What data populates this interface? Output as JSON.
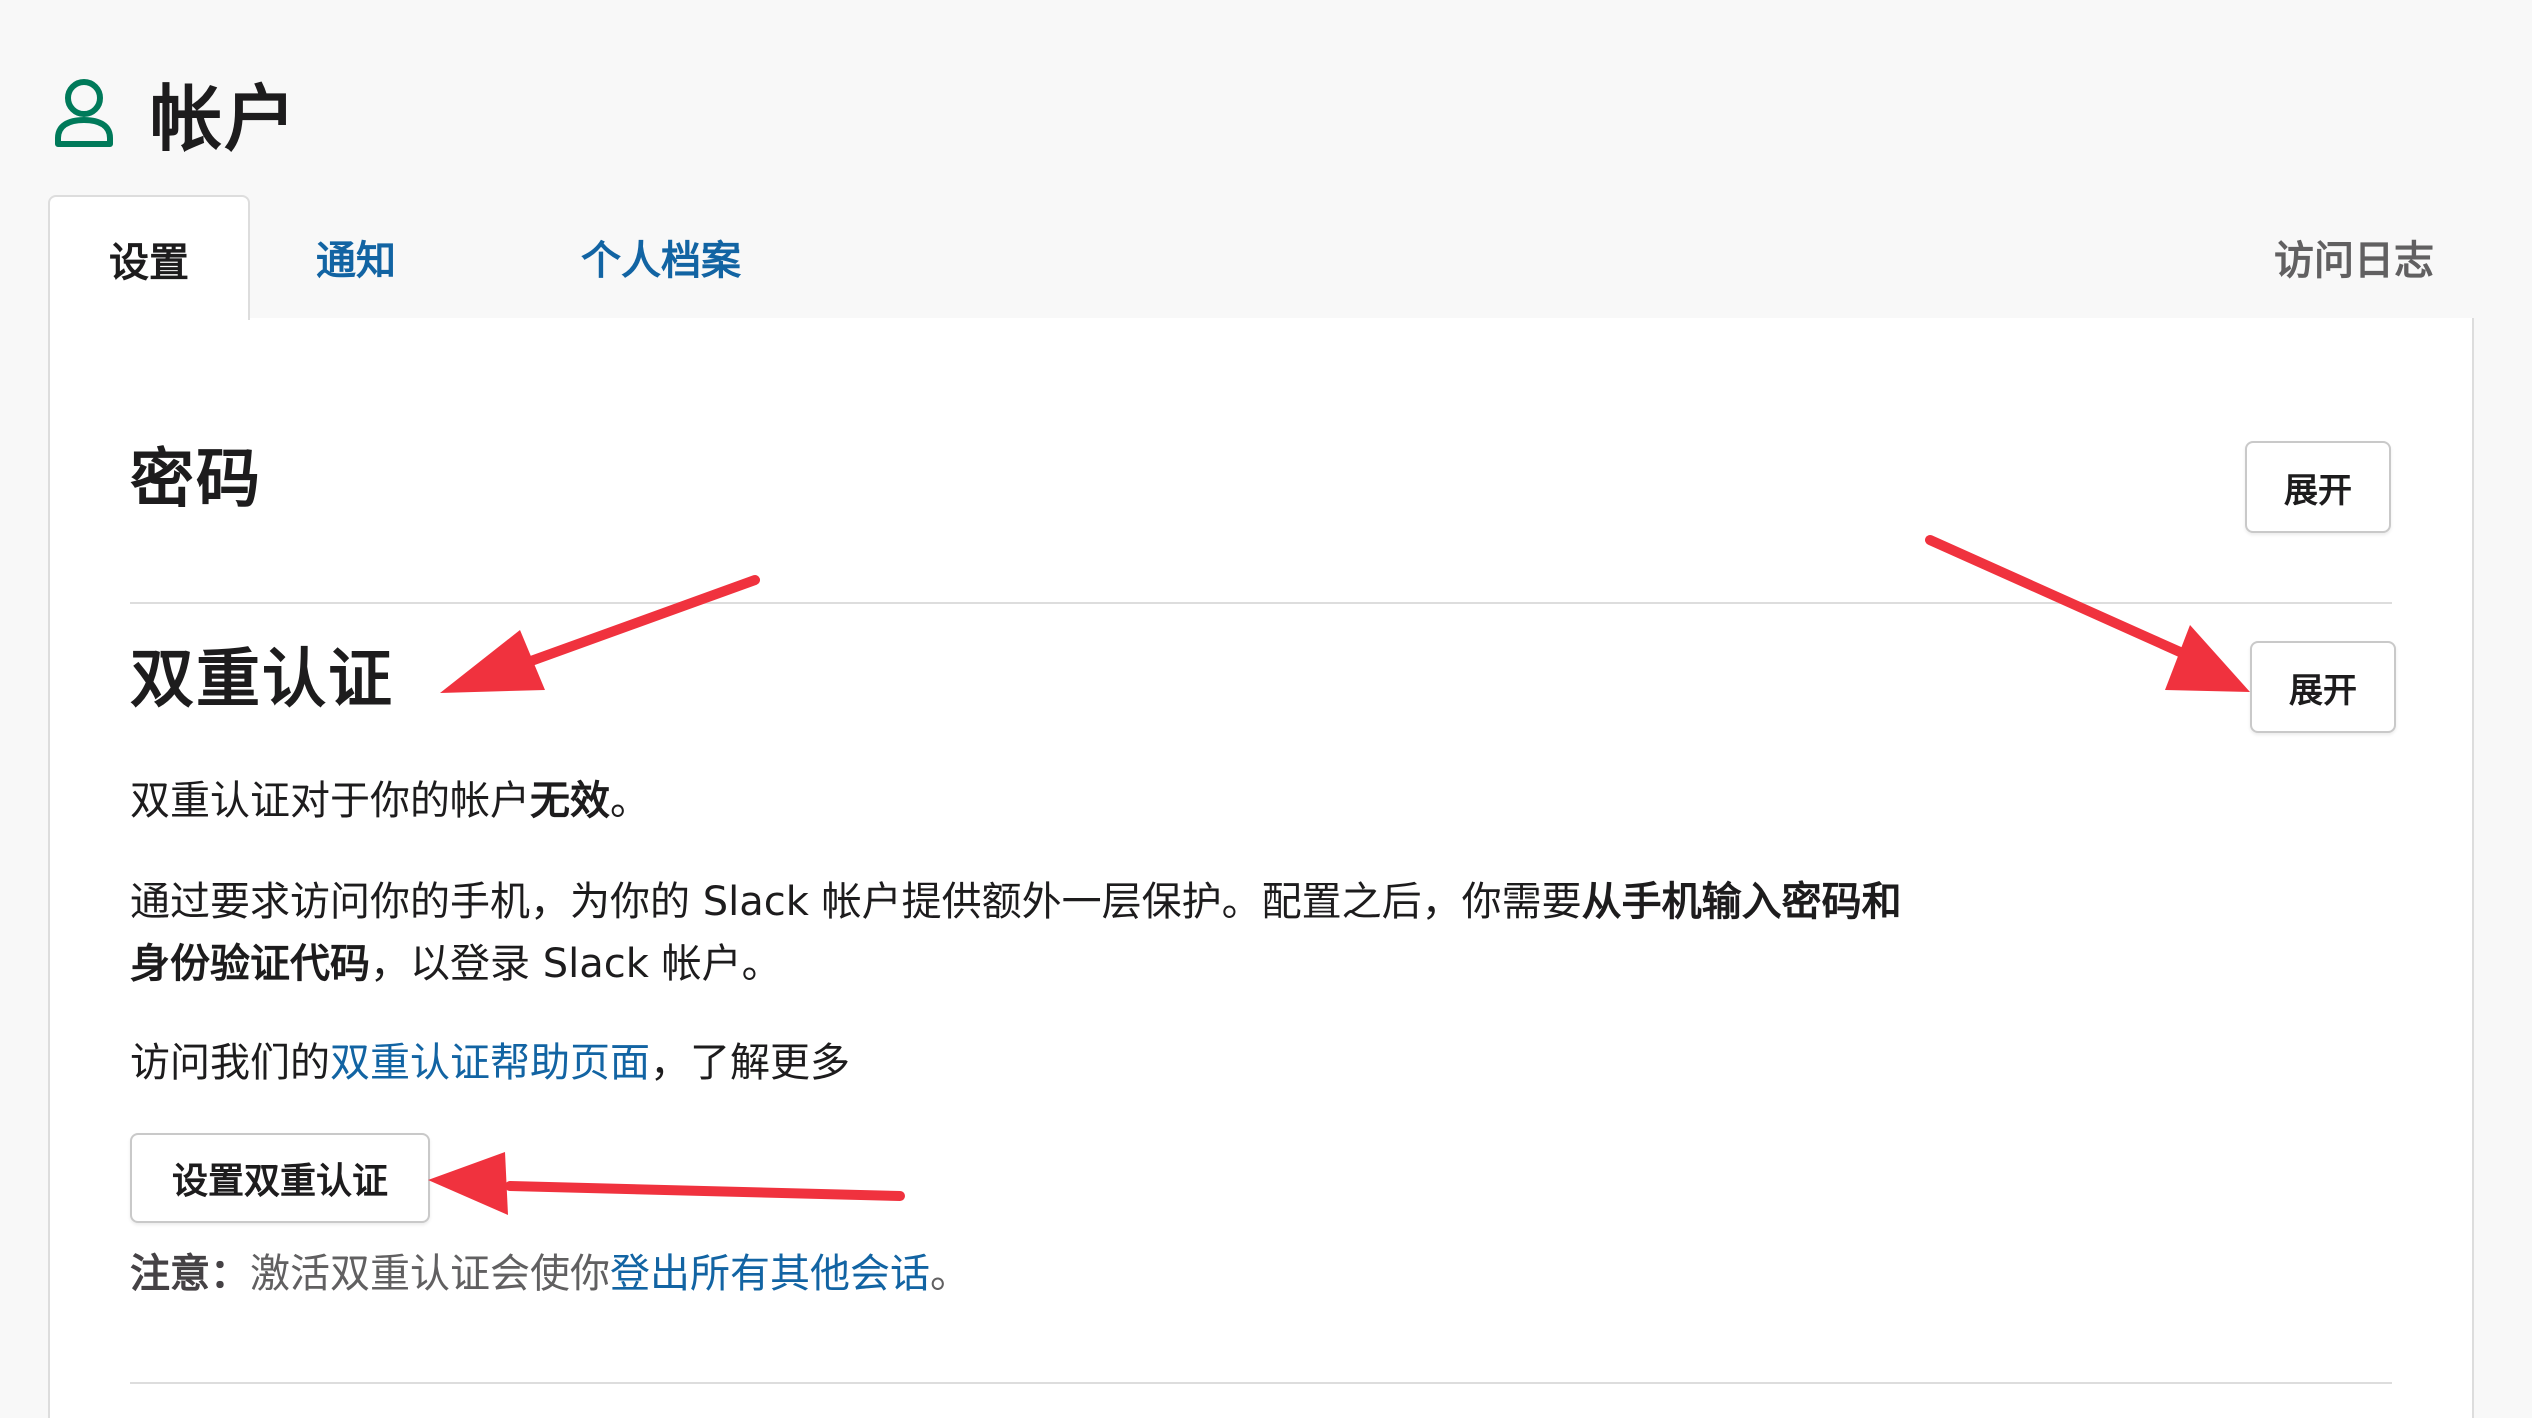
{
  "header": {
    "icon": "user-icon",
    "title": "帐户"
  },
  "tabs": [
    {
      "label": "设置",
      "active": true
    },
    {
      "label": "通知",
      "active": false
    },
    {
      "label": "个人档案",
      "active": false
    },
    {
      "label": "访问日志",
      "active": false
    }
  ],
  "password_section": {
    "title": "密码",
    "expand_label": "展开"
  },
  "two_factor_section": {
    "title": "双重认证",
    "expand_label": "展开",
    "status_prefix": "双重认证对于你的帐户",
    "status_value": "无效",
    "status_suffix": "。",
    "desc_part1": "通过要求访问你的手机，为你的 Slack 帐户提供额外一层保护。配置之后，你需要",
    "desc_bold1": "从手机输入密码和",
    "desc_bold2": "身份验证代码",
    "desc_part2": "，以登录 Slack 帐户。",
    "help_prefix": "访问我们的",
    "help_link": "双重认证帮助页面",
    "help_suffix": "，了解更多",
    "setup_button": "设置双重认证",
    "note_label": "注意：",
    "note_text": "激活双重认证会使你",
    "note_link": "登出所有其他会话",
    "note_suffix": "。"
  },
  "colors": {
    "accent_green": "#007a5a",
    "link_blue": "#1264a3",
    "annotation_red": "#f0323e"
  }
}
